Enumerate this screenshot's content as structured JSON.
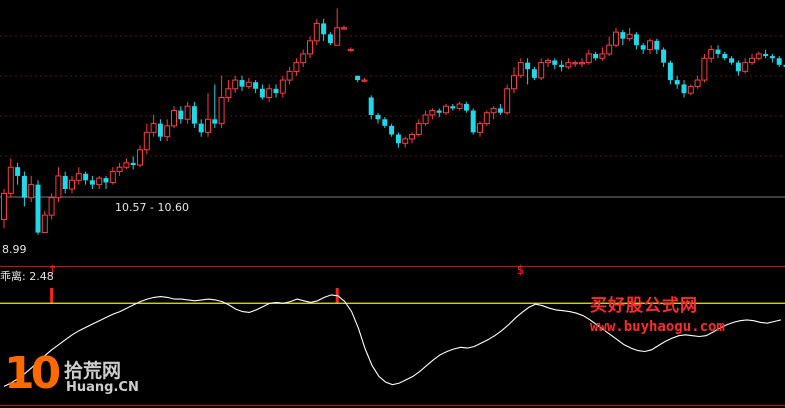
{
  "colors": {
    "background": "#000000",
    "up": "#ff3c3c",
    "down": "#1fd8e8",
    "grid": "#5a0f0f",
    "line": "#ffffff",
    "reference": "#e8e83a",
    "divider": "#b01818"
  },
  "chart_data": [
    {
      "type": "candlestick",
      "labels": {
        "low_price": "8.99",
        "range_label": "10.57 - 10.60"
      },
      "ylim": [
        8.6,
        14.2
      ],
      "candles": [
        [
          9.3,
          9.9,
          9.1,
          10.0
        ],
        [
          9.9,
          10.5,
          9.8,
          10.7
        ],
        [
          10.5,
          10.3,
          10.1,
          10.6
        ],
        [
          10.3,
          9.8,
          9.6,
          10.4
        ],
        [
          9.8,
          10.1,
          9.7,
          10.3
        ],
        [
          10.1,
          9.0,
          8.95,
          10.2
        ],
        [
          9.0,
          9.4,
          8.99,
          9.5
        ],
        [
          9.4,
          9.8,
          9.3,
          9.9
        ],
        [
          9.8,
          10.3,
          9.7,
          10.5
        ],
        [
          10.3,
          10.0,
          9.9,
          10.4
        ],
        [
          10.0,
          10.2,
          9.9,
          10.3
        ],
        [
          10.2,
          10.35,
          10.1,
          10.5
        ],
        [
          10.35,
          10.2,
          10.1,
          10.4
        ],
        [
          10.2,
          10.1,
          10.0,
          10.3
        ],
        [
          10.1,
          10.25,
          10.0,
          10.3
        ],
        [
          10.25,
          10.15,
          10.0,
          10.3
        ],
        [
          10.15,
          10.4,
          10.1,
          10.5
        ],
        [
          10.4,
          10.5,
          10.3,
          10.6
        ],
        [
          10.5,
          10.6,
          10.45,
          10.7
        ],
        [
          10.6,
          10.55,
          10.45,
          10.75
        ],
        [
          10.55,
          10.9,
          10.5,
          11.0
        ],
        [
          10.9,
          11.3,
          10.8,
          11.5
        ],
        [
          11.3,
          11.5,
          11.2,
          11.7
        ],
        [
          11.5,
          11.2,
          11.1,
          11.6
        ],
        [
          11.2,
          11.45,
          11.1,
          11.6
        ],
        [
          11.45,
          11.8,
          11.4,
          11.9
        ],
        [
          11.8,
          11.6,
          11.5,
          11.9
        ],
        [
          11.6,
          11.9,
          11.5,
          12.0
        ],
        [
          11.9,
          11.5,
          11.4,
          12.0
        ],
        [
          11.5,
          11.3,
          11.2,
          11.6
        ],
        [
          11.3,
          11.6,
          11.2,
          12.2
        ],
        [
          11.6,
          11.5,
          11.4,
          12.4
        ],
        [
          11.5,
          12.1,
          11.4,
          12.6
        ],
        [
          12.1,
          12.3,
          12.0,
          12.5
        ],
        [
          12.3,
          12.5,
          12.2,
          12.6
        ],
        [
          12.5,
          12.35,
          12.25,
          12.6
        ],
        [
          12.35,
          12.45,
          12.3,
          12.55
        ],
        [
          12.45,
          12.3,
          12.2,
          12.5
        ],
        [
          12.3,
          12.1,
          12.05,
          12.4
        ],
        [
          12.1,
          12.3,
          12.0,
          12.4
        ],
        [
          12.3,
          12.2,
          12.1,
          12.4
        ],
        [
          12.2,
          12.5,
          12.1,
          12.6
        ],
        [
          12.5,
          12.7,
          12.4,
          12.8
        ],
        [
          12.7,
          12.9,
          12.6,
          13.0
        ],
        [
          12.9,
          13.1,
          12.8,
          13.2
        ],
        [
          13.1,
          13.4,
          13.0,
          13.5
        ],
        [
          13.4,
          13.8,
          13.3,
          13.9
        ],
        [
          13.8,
          13.55,
          13.4,
          13.9
        ],
        [
          13.55,
          13.35,
          13.3,
          13.6
        ],
        [
          13.3,
          13.7,
          13.3,
          14.15
        ],
        [
          13.7,
          13.7,
          13.65,
          13.75
        ],
        [
          13.2,
          13.2,
          13.15,
          13.25
        ],
        [
          12.6,
          12.5,
          12.45,
          12.6
        ],
        [
          12.5,
          12.5,
          12.45,
          12.55
        ],
        [
          12.1,
          11.7,
          11.6,
          12.15
        ],
        [
          11.7,
          11.6,
          11.5,
          11.75
        ],
        [
          11.6,
          11.45,
          11.4,
          11.65
        ],
        [
          11.45,
          11.25,
          11.2,
          11.5
        ],
        [
          11.25,
          11.05,
          10.95,
          11.3
        ],
        [
          11.05,
          11.15,
          10.95,
          11.2
        ],
        [
          11.15,
          11.25,
          11.05,
          11.3
        ],
        [
          11.25,
          11.5,
          11.2,
          11.6
        ],
        [
          11.5,
          11.7,
          11.45,
          11.8
        ],
        [
          11.7,
          11.8,
          11.6,
          11.85
        ],
        [
          11.8,
          11.75,
          11.65,
          11.85
        ],
        [
          11.75,
          11.9,
          11.7,
          11.95
        ],
        [
          11.9,
          11.85,
          11.8,
          11.95
        ],
        [
          11.85,
          11.95,
          11.8,
          12.0
        ],
        [
          11.95,
          11.8,
          11.75,
          12.0
        ],
        [
          11.8,
          11.3,
          11.25,
          11.85
        ],
        [
          11.3,
          11.5,
          11.2,
          11.55
        ],
        [
          11.5,
          11.75,
          11.45,
          11.8
        ],
        [
          11.75,
          11.85,
          11.6,
          11.9
        ],
        [
          11.85,
          11.75,
          11.7,
          11.95
        ],
        [
          11.75,
          12.3,
          11.7,
          12.4
        ],
        [
          12.3,
          12.6,
          12.2,
          12.8
        ],
        [
          12.6,
          12.9,
          12.55,
          13.0
        ],
        [
          12.9,
          12.75,
          12.4,
          13.0
        ],
        [
          12.75,
          12.55,
          12.5,
          12.8
        ],
        [
          12.55,
          12.9,
          12.5,
          13.0
        ],
        [
          12.9,
          12.95,
          12.8,
          13.0
        ],
        [
          12.95,
          12.85,
          12.75,
          13.0
        ],
        [
          12.85,
          12.8,
          12.7,
          12.95
        ],
        [
          12.8,
          12.9,
          12.75,
          13.0
        ],
        [
          12.9,
          12.9,
          12.8,
          12.95
        ],
        [
          12.9,
          12.9,
          12.8,
          13.0
        ],
        [
          12.9,
          13.1,
          12.85,
          13.2
        ],
        [
          13.1,
          13.0,
          12.95,
          13.15
        ],
        [
          13.0,
          13.1,
          12.95,
          13.25
        ],
        [
          13.1,
          13.3,
          13.05,
          13.5
        ],
        [
          13.3,
          13.6,
          13.25,
          13.7
        ],
        [
          13.6,
          13.45,
          13.3,
          13.65
        ],
        [
          13.45,
          13.55,
          13.4,
          13.7
        ],
        [
          13.55,
          13.3,
          13.2,
          13.6
        ],
        [
          13.3,
          13.2,
          13.1,
          13.35
        ],
        [
          13.2,
          13.4,
          13.1,
          13.45
        ],
        [
          13.4,
          13.2,
          13.1,
          13.45
        ],
        [
          13.2,
          12.9,
          12.8,
          13.25
        ],
        [
          12.9,
          12.5,
          12.4,
          12.95
        ],
        [
          12.5,
          12.4,
          12.3,
          12.6
        ],
        [
          12.4,
          12.2,
          12.1,
          12.5
        ],
        [
          12.2,
          12.35,
          12.15,
          12.4
        ],
        [
          12.35,
          12.5,
          12.3,
          12.6
        ],
        [
          12.5,
          13.0,
          12.45,
          13.1
        ],
        [
          13.0,
          13.2,
          12.9,
          13.3
        ],
        [
          13.2,
          13.1,
          13.0,
          13.3
        ],
        [
          13.1,
          13.0,
          12.95,
          13.15
        ],
        [
          13.0,
          12.9,
          12.85,
          13.05
        ],
        [
          12.9,
          12.7,
          12.6,
          12.95
        ],
        [
          12.7,
          12.9,
          12.65,
          13.0
        ],
        [
          12.9,
          13.0,
          12.85,
          13.1
        ],
        [
          13.0,
          13.1,
          12.95,
          13.15
        ],
        [
          13.1,
          13.05,
          13.0,
          13.2
        ],
        [
          13.05,
          13.0,
          12.9,
          13.1
        ],
        [
          13.0,
          12.85,
          12.8,
          13.05
        ],
        [
          12.85,
          12.8,
          12.7,
          12.9
        ],
        [
          12.8,
          13.4,
          12.75,
          13.6
        ]
      ]
    },
    {
      "type": "line",
      "name": "乖离",
      "value_label": "2.48",
      "ylim": [
        -10,
        6
      ],
      "reference": 2.0,
      "signal_bars": [
        7,
        49
      ],
      "signal_marks": [
        {
          "index": 7,
          "glyph": "↑"
        },
        {
          "index": 76,
          "glyph": "$"
        }
      ],
      "values": [
        -8.0,
        -7.6,
        -7.1,
        -6.5,
        -5.8,
        -5.0,
        -4.3,
        -3.6,
        -3.0,
        -2.4,
        -1.8,
        -1.3,
        -0.9,
        -0.5,
        -0.1,
        0.3,
        0.7,
        1.0,
        1.4,
        1.8,
        2.2,
        2.5,
        2.7,
        2.8,
        2.7,
        2.5,
        2.5,
        2.4,
        2.3,
        2.4,
        2.5,
        2.4,
        2.2,
        1.8,
        1.3,
        1.0,
        0.9,
        1.2,
        1.6,
        2.0,
        2.1,
        2.0,
        2.2,
        2.5,
        2.3,
        2.1,
        2.3,
        2.7,
        3.0,
        2.9,
        2.2,
        1.0,
        -1.0,
        -3.5,
        -5.5,
        -6.8,
        -7.5,
        -7.8,
        -7.6,
        -7.2,
        -6.8,
        -6.2,
        -5.5,
        -4.8,
        -4.2,
        -3.8,
        -3.5,
        -3.3,
        -3.4,
        -3.2,
        -2.8,
        -2.4,
        -1.9,
        -1.3,
        -0.6,
        0.2,
        0.9,
        1.5,
        1.9,
        1.7,
        1.4,
        1.2,
        1.1,
        1.0,
        0.8,
        0.5,
        0.0,
        -0.6,
        -1.2,
        -1.8,
        -2.4,
        -3.0,
        -3.4,
        -3.7,
        -3.8,
        -3.6,
        -3.1,
        -2.6,
        -2.2,
        -1.9,
        -1.8,
        -1.9,
        -2.0,
        -1.9,
        -1.5,
        -1.0,
        -0.6,
        -0.3,
        -0.1,
        0.0,
        -0.1,
        -0.3,
        -0.4,
        -0.2,
        0.0
      ]
    }
  ],
  "watermark": {
    "title": "买好股公式网",
    "url": "www.buyhaogu.com"
  },
  "logo": {
    "number": "10",
    "cn": "拾荒网",
    "en": "Huang.CN"
  },
  "icons": [
    "logo-mark"
  ]
}
